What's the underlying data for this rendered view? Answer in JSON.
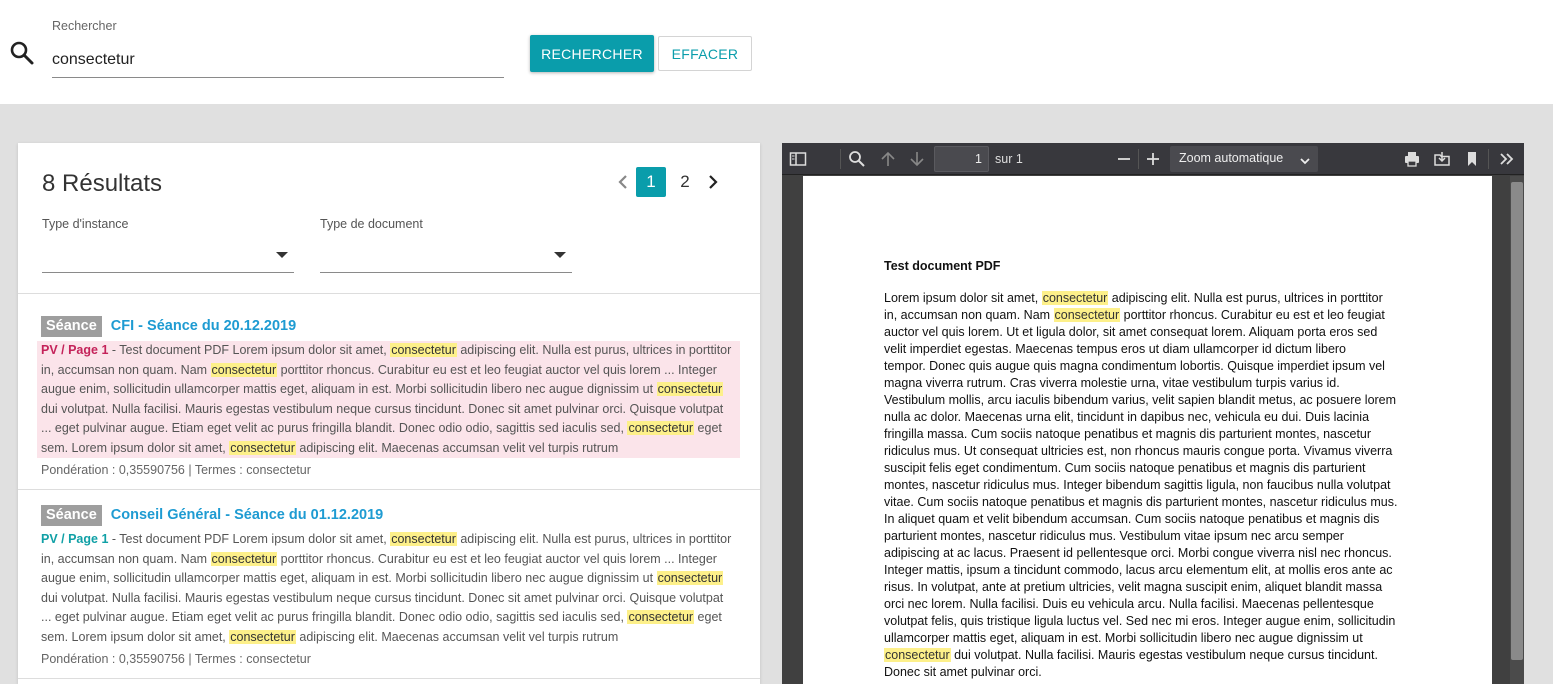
{
  "search": {
    "label": "Rechercher",
    "value": "consectetur",
    "search_button": "RECHERCHER",
    "clear_button": "EFFACER"
  },
  "results_panel": {
    "count_label": "8 Résultats",
    "pagination": {
      "pages": [
        "1",
        "2"
      ],
      "current": "1"
    },
    "filters": [
      {
        "label": "Type d'instance",
        "value": ""
      },
      {
        "label": "Type de document",
        "value": ""
      }
    ],
    "items": [
      {
        "badge": "Séance",
        "title": "CFI - Séance du 20.12.2019",
        "source": "PV / Page 1",
        "highlighted": true,
        "snippet": [
          {
            "t": " - Test document PDF Lorem ipsum dolor sit amet, "
          },
          {
            "t": "consectetur",
            "hl": true
          },
          {
            "t": " adipiscing elit. Nulla est purus, ultrices in porttitor in, accumsan non quam. Nam "
          },
          {
            "t": "consectetur",
            "hl": true
          },
          {
            "t": " porttitor rhoncus. Curabitur eu est et leo feugiat auctor vel quis lorem ... Integer augue enim, sollicitudin ullamcorper mattis eget, aliquam in est. Morbi sollicitudin libero nec augue dignissim ut "
          },
          {
            "t": "consectetur",
            "hl": true
          },
          {
            "t": " dui volutpat. Nulla facilisi. Mauris egestas vestibulum neque cursus tincidunt. Donec sit amet pulvinar orci. Quisque volutpat ... eget pulvinar augue. Etiam eget velit ac purus fringilla blandit. Donec odio odio, sagittis sed iaculis sed, "
          },
          {
            "t": "consectetur",
            "hl": true
          },
          {
            "t": " eget sem. Lorem ipsum dolor sit amet, "
          },
          {
            "t": "consectetur",
            "hl": true
          },
          {
            "t": " adipiscing elit. Maecenas accumsan velit vel turpis rutrum"
          }
        ],
        "meta": "Pondération : 0,35590756 | Termes : consectetur"
      },
      {
        "badge": "Séance",
        "title": "Conseil Général - Séance du 01.12.2019",
        "source": "PV / Page 1",
        "highlighted": false,
        "snippet": [
          {
            "t": " - Test document PDF Lorem ipsum dolor sit amet, "
          },
          {
            "t": "consectetur",
            "hl": true
          },
          {
            "t": " adipiscing elit. Nulla est purus, ultrices in porttitor in, accumsan non quam. Nam "
          },
          {
            "t": "consectetur",
            "hl": true
          },
          {
            "t": " porttitor rhoncus. Curabitur eu est et leo feugiat auctor vel quis lorem ... Integer augue enim, sollicitudin ullamcorper mattis eget, aliquam in est. Morbi sollicitudin libero nec augue dignissim ut "
          },
          {
            "t": "consectetur",
            "hl": true
          },
          {
            "t": " dui volutpat. Nulla facilisi. Mauris egestas vestibulum neque cursus tincidunt. Donec sit amet pulvinar orci. Quisque volutpat ... eget pulvinar augue. Etiam eget velit ac purus fringilla blandit. Donec odio odio, sagittis sed iaculis sed, "
          },
          {
            "t": "consectetur",
            "hl": true
          },
          {
            "t": " eget sem. Lorem ipsum dolor sit amet, "
          },
          {
            "t": "consectetur",
            "hl": true
          },
          {
            "t": " adipiscing elit. Maecenas accumsan velit vel turpis rutrum"
          }
        ],
        "meta": "Pondération : 0,35590756 | Termes : consectetur"
      }
    ]
  },
  "viewer": {
    "page_value": "1",
    "page_of": "sur 1",
    "zoom": "Zoom automatique",
    "document": {
      "title": "Test document PDF",
      "lines": [
        [
          {
            "t": "Lorem ipsum dolor sit amet, "
          },
          {
            "t": "consectetur",
            "hl": true
          },
          {
            "t": " adipiscing elit. Nulla est purus, ultrices in porttitor"
          }
        ],
        [
          {
            "t": "in, accumsan non quam. Nam "
          },
          {
            "t": "consectetur",
            "hl": true
          },
          {
            "t": " porttitor rhoncus. Curabitur eu est et leo feugiat"
          }
        ],
        [
          {
            "t": "auctor vel quis lorem. Ut et ligula dolor, sit amet consequat lorem. Aliquam porta eros sed"
          }
        ],
        [
          {
            "t": "velit imperdiet egestas. Maecenas tempus eros ut diam ullamcorper id dictum libero"
          }
        ],
        [
          {
            "t": "tempor. Donec quis augue quis magna condimentum lobortis. Quisque imperdiet ipsum vel"
          }
        ],
        [
          {
            "t": "magna viverra rutrum. Cras viverra molestie urna, vitae vestibulum turpis varius id."
          }
        ],
        [
          {
            "t": "Vestibulum mollis, arcu iaculis bibendum varius, velit sapien blandit metus, ac posuere lorem"
          }
        ],
        [
          {
            "t": "nulla ac dolor. Maecenas urna elit, tincidunt in dapibus nec, vehicula eu dui. Duis lacinia"
          }
        ],
        [
          {
            "t": "fringilla massa. Cum sociis natoque penatibus et magnis dis parturient montes, nascetur"
          }
        ],
        [
          {
            "t": "ridiculus mus. Ut consequat ultricies est, non rhoncus mauris congue porta. Vivamus viverra"
          }
        ],
        [
          {
            "t": "suscipit felis eget condimentum. Cum sociis natoque penatibus et magnis dis parturient"
          }
        ],
        [
          {
            "t": "montes, nascetur ridiculus mus. Integer bibendum sagittis ligula, non faucibus nulla volutpat"
          }
        ],
        [
          {
            "t": "vitae. Cum sociis natoque penatibus et magnis dis parturient montes, nascetur ridiculus mus."
          }
        ],
        [
          {
            "t": "In aliquet quam et velit bibendum accumsan. Cum sociis natoque penatibus et magnis dis"
          }
        ],
        [
          {
            "t": "parturient montes, nascetur ridiculus mus. Vestibulum vitae ipsum nec arcu semper"
          }
        ],
        [
          {
            "t": "adipiscing at ac lacus. Praesent id pellentesque orci. Morbi congue viverra nisl nec rhoncus."
          }
        ],
        [
          {
            "t": "Integer mattis, ipsum a tincidunt commodo, lacus arcu elementum elit, at mollis eros ante ac"
          }
        ],
        [
          {
            "t": "risus. In volutpat, ante at pretium ultricies, velit magna suscipit enim, aliquet blandit massa"
          }
        ],
        [
          {
            "t": "orci nec lorem. Nulla facilisi. Duis eu vehicula arcu. Nulla facilisi. Maecenas pellentesque"
          }
        ],
        [
          {
            "t": "volutpat felis, quis tristique ligula luctus vel. Sed nec mi eros. Integer augue enim, sollicitudin"
          }
        ],
        [
          {
            "t": "ullamcorper mattis eget, aliquam in est. Morbi sollicitudin libero nec augue dignissim ut"
          }
        ],
        [
          {
            "t": "consectetur",
            "hl": true
          },
          {
            "t": " dui volutpat. Nulla facilisi. Mauris egestas vestibulum neque cursus tincidunt."
          }
        ],
        [
          {
            "t": "Donec sit amet pulvinar orci."
          }
        ]
      ]
    }
  },
  "colors": {
    "accent": "#0a9dab",
    "title_link": "#1e9bd2",
    "highlight": "#fdf08a",
    "active_row": "#fbe4ea",
    "source_active": "#c4235a",
    "source_default": "#10a0a6"
  },
  "icons": [
    "search-icon",
    "chevron-left-icon",
    "chevron-right-icon",
    "dropdown-arrow-icon",
    "sidebar-toggle-icon",
    "find-icon",
    "arrow-up-icon",
    "arrow-down-icon",
    "zoom-out-icon",
    "zoom-in-icon",
    "print-icon",
    "download-icon",
    "bookmark-icon",
    "more-tools-icon"
  ]
}
